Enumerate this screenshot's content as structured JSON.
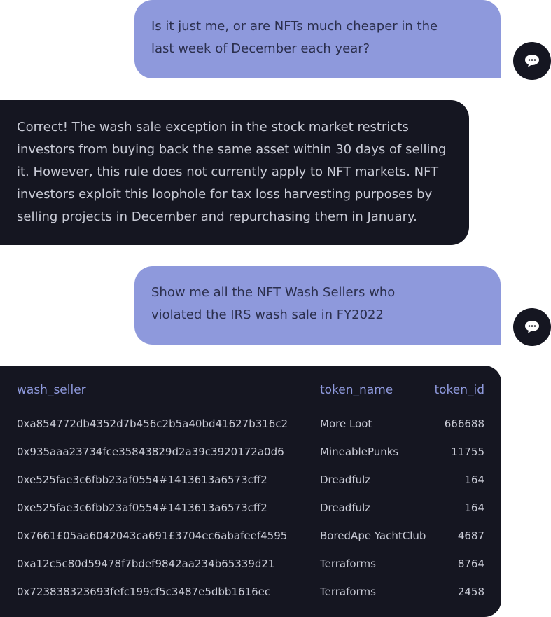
{
  "messages": [
    {
      "role": "user",
      "text": "Is it just me, or are NFTs much cheaper in the last week of December each year?"
    },
    {
      "role": "assistant",
      "text": "Correct! The wash sale exception in the stock market restricts investors from buying back the same asset within 30 days of selling it. However, this rule does not currently apply to NFT markets. NFT investors exploit this loophole for tax loss harvesting purposes by selling projects in December and repurchasing them in January."
    },
    {
      "role": "user",
      "text": "Show me all the NFT Wash Sellers who violated the IRS wash sale in FY2022"
    }
  ],
  "icons": {
    "chat": "chat-bubble-icon"
  },
  "colors": {
    "user_bubble": "#8e99dc",
    "bot_bubble": "#151621",
    "header_text": "#8e99dc",
    "body_text": "#c9cbd6"
  },
  "table": {
    "columns": [
      "wash_seller",
      "token_name",
      "token_id"
    ],
    "rows": [
      [
        "0xa854772db4352d7b456c2b5a40bd41627b316c2",
        "More Loot",
        "666688"
      ],
      [
        "0x935aaa23734fce35843829d2a39c3920172a0d6",
        "MineablePunks",
        "11755"
      ],
      [
        "0xe525fae3c6fbb23af0554#1413613a6573cff2",
        "Dreadfulz",
        "164"
      ],
      [
        "0xe525fae3c6fbb23af0554#1413613a6573cff2",
        "Dreadfulz",
        "164"
      ],
      [
        "0x7661£05aa6042043ca691£3704ec6abafeef4595",
        "BoredApe YachtClub",
        "4687"
      ],
      [
        "0xa12c5c80d59478f7bdef9842aa234b65339d21",
        "Terraforms",
        "8764"
      ],
      [
        "0x723838323693fefc199cf5c3487e5dbb1616ec",
        "Terraforms",
        "2458"
      ]
    ]
  }
}
